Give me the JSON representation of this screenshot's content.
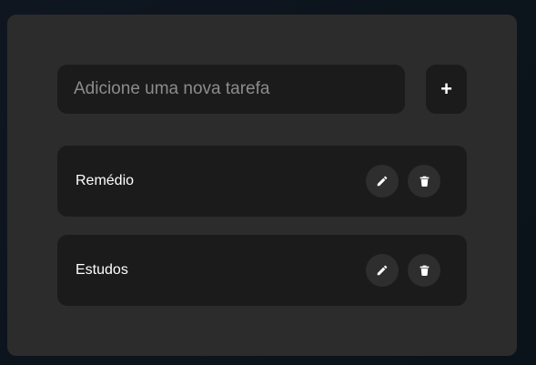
{
  "new_task": {
    "placeholder": "Adicione uma nova tarefa",
    "value": "",
    "add_label": "+"
  },
  "tasks": [
    {
      "label": "Remédio",
      "edit_icon": "pencil-icon",
      "delete_icon": "trash-icon"
    },
    {
      "label": "Estudos",
      "edit_icon": "pencil-icon",
      "delete_icon": "trash-icon"
    }
  ],
  "colors": {
    "background": "#0c141c",
    "card": "#2c2c2c",
    "input": "#1b1b1b",
    "icon_button": "#2e2e2e",
    "text": "#ffffff",
    "placeholder": "#8c8c8c"
  }
}
